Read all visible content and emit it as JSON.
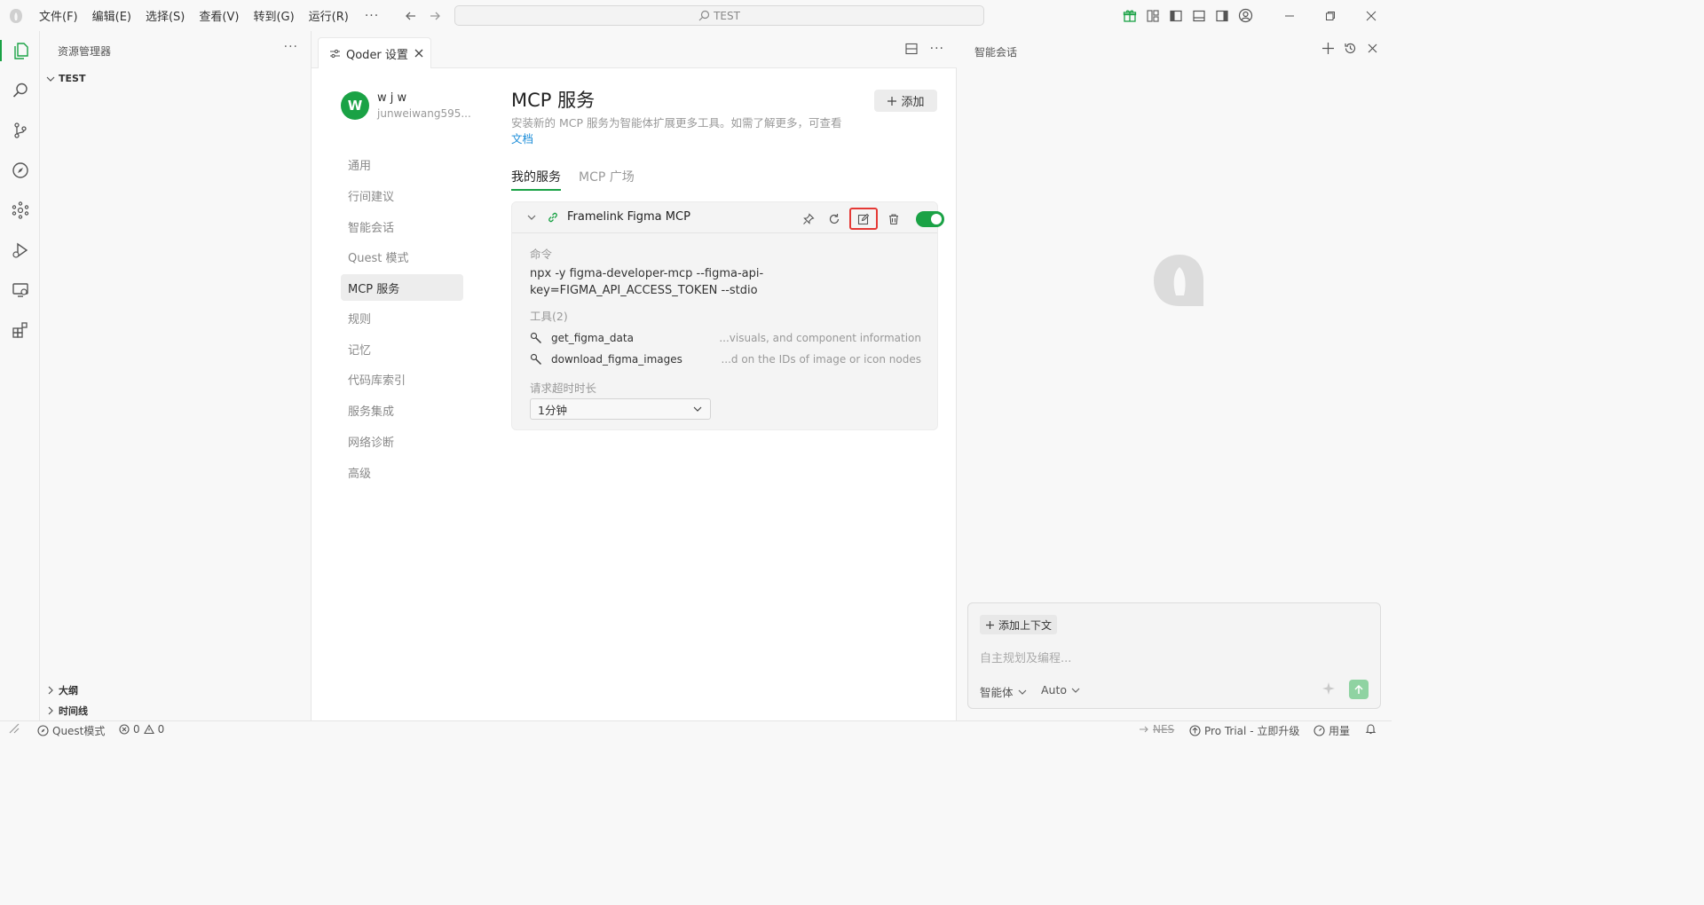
{
  "menu": [
    "文件(F)",
    "编辑(E)",
    "选择(S)",
    "查看(V)",
    "转到(G)",
    "运行(R)"
  ],
  "menu_more": "···",
  "search": {
    "text": "TEST"
  },
  "explorer": {
    "title": "资源管理器",
    "more": "···",
    "folder": "TEST",
    "outline": "大纲",
    "timeline": "时间线"
  },
  "tab": {
    "title": "Qoder 设置",
    "more": "···"
  },
  "profile": {
    "initial": "W",
    "name": "w j w",
    "email": "junweiwang595..."
  },
  "settings_nav": [
    "通用",
    "行间建议",
    "智能会话",
    "Quest 模式",
    "MCP 服务",
    "规则",
    "记忆",
    "代码库索引",
    "服务集成",
    "网络诊断",
    "高级"
  ],
  "settings_active_index": 4,
  "mcp": {
    "title": "MCP 服务",
    "desc": "安装新的 MCP 服务为智能体扩展更多工具。如需了解更多，可查看",
    "doc_link": "文档",
    "add_label": "添加",
    "tabs": [
      "我的服务",
      "MCP 广场"
    ],
    "server": {
      "name": "Framelink Figma MCP",
      "enabled": true,
      "command_label": "命令",
      "command": "npx -y figma-developer-mcp --figma-api-key=FIGMA_API_ACCESS_TOKEN --stdio",
      "tools_label": "工具(2)",
      "tools": [
        {
          "name": "get_figma_data",
          "desc": "...visuals, and component information"
        },
        {
          "name": "download_figma_images",
          "desc": "...d on the IDs of image or icon nodes"
        }
      ],
      "timeout_label": "请求超时时长",
      "timeout_value": "1分钟"
    }
  },
  "chat": {
    "title": "智能会话",
    "add_context": "添加上下文",
    "placeholder": "自主规划及编程...",
    "mode": "智能体",
    "model": "Auto"
  },
  "status": {
    "quest": "Quest模式",
    "errors": "0",
    "warnings": "0",
    "nes": "NES",
    "pro": "Pro Trial - 立即升级",
    "usage": "用量"
  },
  "colors": {
    "accent": "#1aa245",
    "highlight": "#e53935",
    "link": "#1a8cd8"
  }
}
